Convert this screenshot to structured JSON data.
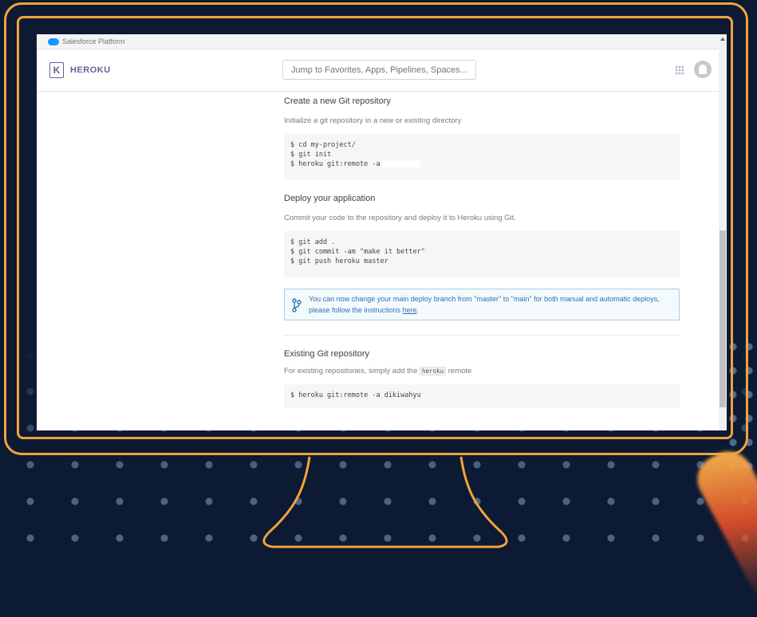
{
  "platform_bar": {
    "label": "Salesforce Platform"
  },
  "header": {
    "logo_glyph": "K",
    "brand": "HEROKU",
    "search_placeholder": "Jump to Favorites, Apps, Pipelines, Spaces..."
  },
  "sections": {
    "new_repo": {
      "title": "Create a new Git repository",
      "desc": "Initialize a git repository in a new or existing directory",
      "lines": [
        "$ cd my-project/",
        "$ git init",
        "$ heroku git:remote -a"
      ]
    },
    "deploy": {
      "title": "Deploy your application",
      "desc": "Commit your code to the repository and deploy it to Heroku using Git.",
      "lines": [
        "$ git add .",
        "$ git commit -am \"make it better\"",
        "$ git push heroku master"
      ]
    },
    "notice": {
      "text": "You can now change your main deploy branch from \"master\" to \"main\" for both manual and automatic deploys, please follow the instructions",
      "link": "here",
      "end": "."
    },
    "existing": {
      "title": "Existing Git repository",
      "desc_prefix": "For existing repositories, simply add the",
      "desc_code": "heroku",
      "desc_suffix": "remote",
      "lines": [
        "$ heroku git:remote -a dikiwahyu"
      ]
    }
  },
  "colors": {
    "frame": "#f2a33a",
    "background": "#0c1a33",
    "heroku_purple": "#6b5c96",
    "notice_blue": "#2b73b5"
  }
}
